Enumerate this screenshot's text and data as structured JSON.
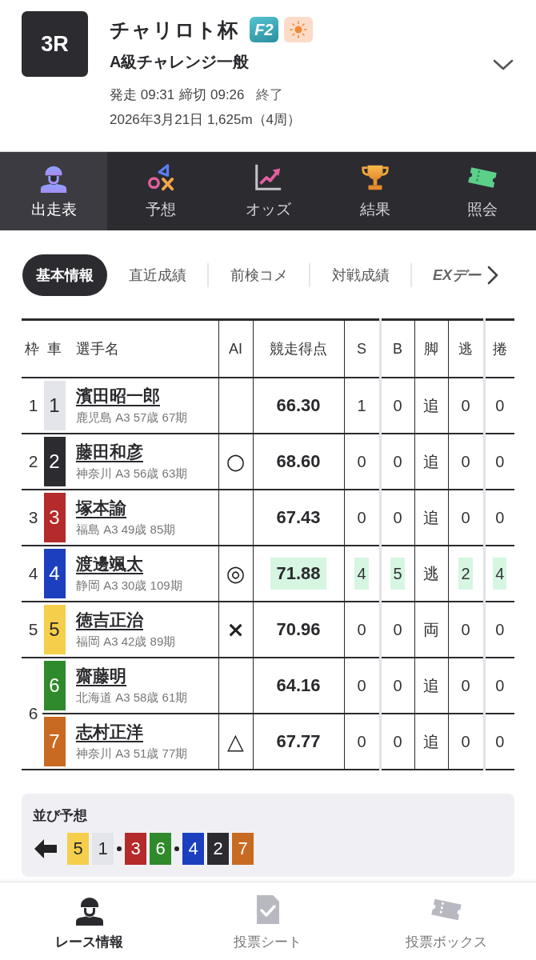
{
  "header": {
    "race_number": "3R",
    "title": "チャリロト杯",
    "grade": "F2",
    "race_class": "A級チャレンジ一般",
    "start": "発走 09:31",
    "deadline": "締切 09:26",
    "status": "終了",
    "schedule": "2026年3月21日 1,625m（4周）"
  },
  "nav_tabs": [
    {
      "label": "出走表",
      "selected": true
    },
    {
      "label": "予想",
      "selected": false
    },
    {
      "label": "オッズ",
      "selected": false
    },
    {
      "label": "結果",
      "selected": false
    },
    {
      "label": "照会",
      "selected": false
    }
  ],
  "sub_tabs": [
    {
      "label": "基本情報",
      "kind": "text",
      "selected": true
    },
    {
      "label": "直近成績",
      "kind": "text",
      "selected": false
    },
    {
      "label": "前検コメ",
      "kind": "text",
      "selected": false
    },
    {
      "label": "対戦成績",
      "kind": "text",
      "selected": false
    },
    {
      "label": "EXデー",
      "kind": "brand",
      "selected": false
    }
  ],
  "table": {
    "columns": [
      "枠",
      "車",
      "選手名",
      "AI",
      "競走得点",
      "S",
      "B",
      "脚",
      "逃",
      "捲"
    ],
    "frames": [
      {
        "number": "1",
        "riders": [
          {
            "car": "1",
            "color": "#e4e5ea",
            "name": "濱田昭一郎",
            "profile": "鹿児島 A3 57歳 67期",
            "score": {
              "value": "66.30",
              "best": false
            },
            "s": {
              "value": "1",
              "best": false
            },
            "b": {
              "value": "0",
              "best": false
            },
            "leg": "追",
            "nige": {
              "value": "0",
              "best": false
            },
            "makuri": {
              "value": "0",
              "best": false
            }
          }
        ]
      },
      {
        "number": "2",
        "riders": [
          {
            "car": "2",
            "color": "#2b2b30",
            "name": "藤田和彦",
            "profile": "神奈川 A3 56歳 63期",
            "ai_mark": "○",
            "score": {
              "value": "68.60",
              "best": false
            },
            "s": {
              "value": "0",
              "best": false
            },
            "b": {
              "value": "0",
              "best": false
            },
            "leg": "追",
            "nige": {
              "value": "0",
              "best": false
            },
            "makuri": {
              "value": "0",
              "best": false
            }
          }
        ]
      },
      {
        "number": "3",
        "riders": [
          {
            "car": "3",
            "color": "#b52a2a",
            "name": "塚本諭",
            "profile": "福島 A3 49歳 85期",
            "score": {
              "value": "67.43",
              "best": false
            },
            "s": {
              "value": "0",
              "best": false
            },
            "b": {
              "value": "0",
              "best": false
            },
            "leg": "追",
            "nige": {
              "value": "0",
              "best": false
            },
            "makuri": {
              "value": "0",
              "best": false
            }
          }
        ]
      },
      {
        "number": "4",
        "riders": [
          {
            "car": "4",
            "color": "#1c3fc0",
            "name": "渡邊颯太",
            "profile": "静岡 A3 30歳 109期",
            "ai_mark": "◎",
            "score": {
              "value": "71.88",
              "best": true
            },
            "s": {
              "value": "4",
              "best": true
            },
            "b": {
              "value": "5",
              "best": true
            },
            "leg": "逃",
            "nige": {
              "value": "2",
              "best": true
            },
            "makuri": {
              "value": "4",
              "best": true
            }
          }
        ]
      },
      {
        "number": "5",
        "riders": [
          {
            "car": "5",
            "color": "#f5cf4b",
            "name": "徳吉正治",
            "profile": "福岡 A3 42歳 89期",
            "ai_mark": "×",
            "score": {
              "value": "70.96",
              "best": false
            },
            "s": {
              "value": "0",
              "best": false
            },
            "b": {
              "value": "0",
              "best": false
            },
            "leg": "両",
            "nige": {
              "value": "0",
              "best": false
            },
            "makuri": {
              "value": "0",
              "best": false
            }
          }
        ]
      },
      {
        "number": "6",
        "riders": [
          {
            "car": "6",
            "color": "#2f8a2b",
            "name": "齋藤明",
            "profile": "北海道 A3 58歳 61期",
            "score": {
              "value": "64.16",
              "best": false
            },
            "s": {
              "value": "0",
              "best": false
            },
            "b": {
              "value": "0",
              "best": false
            },
            "leg": "追",
            "nige": {
              "value": "0",
              "best": false
            },
            "makuri": {
              "value": "0",
              "best": false
            }
          },
          {
            "car": "7",
            "color": "#c96a23",
            "name": "志村正洋",
            "profile": "神奈川 A3 51歳 77期",
            "ai_mark": "△",
            "score": {
              "value": "67.77",
              "best": false
            },
            "s": {
              "value": "0",
              "best": false
            },
            "b": {
              "value": "0",
              "best": false
            },
            "leg": "追",
            "nige": {
              "value": "0",
              "best": false
            },
            "makuri": {
              "value": "0",
              "best": false
            }
          }
        ]
      }
    ]
  },
  "line_prediction": {
    "title": "並び予想",
    "lines": [
      {
        "cars": [
          {
            "car": "5",
            "color": "#f5cf4b"
          },
          {
            "car": "1",
            "color": "#e4e5ea"
          }
        ]
      },
      {
        "cars": [
          {
            "car": "3",
            "color": "#b52a2a"
          },
          {
            "car": "6",
            "color": "#2f8a2b"
          }
        ]
      },
      {
        "cars": [
          {
            "car": "4",
            "color": "#1c3fc0"
          },
          {
            "car": "2",
            "color": "#2b2b30"
          },
          {
            "car": "7",
            "color": "#c96a23"
          }
        ]
      }
    ]
  },
  "bottom_nav": [
    {
      "label": "レース情報",
      "selected": true
    },
    {
      "label": "投票シート",
      "selected": false
    },
    {
      "label": "投票ボックス",
      "selected": false
    }
  ]
}
